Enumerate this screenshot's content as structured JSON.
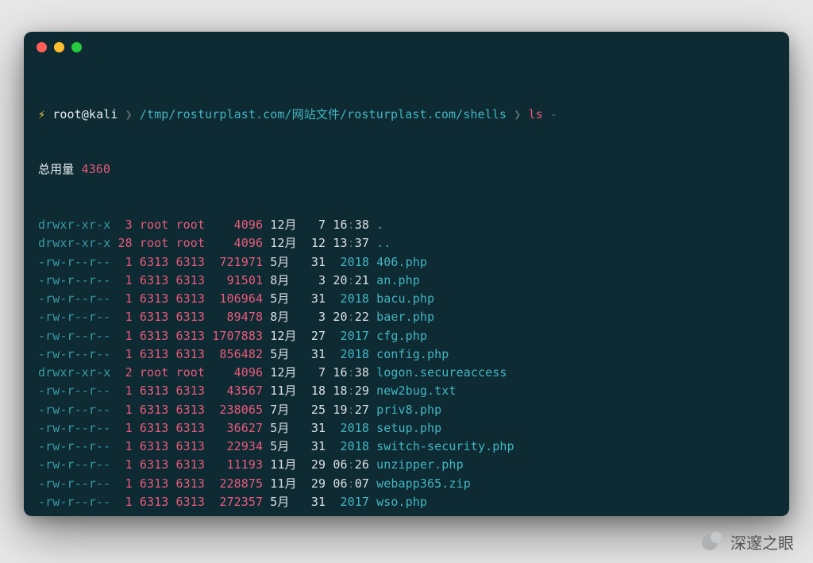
{
  "prompt": {
    "bolt": "⚡",
    "user_host": "root@kali",
    "sep": "❯",
    "path": "/tmp/rosturplast.com/网站文件/rosturplast.com/shells",
    "command": "ls",
    "flag": "-"
  },
  "total_label": "总用量",
  "total_value": "4360",
  "rows": [
    {
      "perm": "drwxr-xr-x",
      "links": "3",
      "owner": "root",
      "group": "root",
      "size": "4096",
      "mon": "12月",
      "day": "7",
      "time": "16:38",
      "year": "",
      "name": "."
    },
    {
      "perm": "drwxr-xr-x",
      "links": "28",
      "owner": "root",
      "group": "root",
      "size": "4096",
      "mon": "12月",
      "day": "12",
      "time": "13:37",
      "year": "",
      "name": ".."
    },
    {
      "perm": "-rw-r--r--",
      "links": "1",
      "owner": "6313",
      "group": "6313",
      "size": "721971",
      "mon": "5月",
      "day": "31",
      "time": "",
      "year": "2018",
      "name": "406.php"
    },
    {
      "perm": "-rw-r--r--",
      "links": "1",
      "owner": "6313",
      "group": "6313",
      "size": "91501",
      "mon": "8月",
      "day": "3",
      "time": "20:21",
      "year": "",
      "name": "an.php"
    },
    {
      "perm": "-rw-r--r--",
      "links": "1",
      "owner": "6313",
      "group": "6313",
      "size": "106964",
      "mon": "5月",
      "day": "31",
      "time": "",
      "year": "2018",
      "name": "bacu.php"
    },
    {
      "perm": "-rw-r--r--",
      "links": "1",
      "owner": "6313",
      "group": "6313",
      "size": "89478",
      "mon": "8月",
      "day": "3",
      "time": "20:22",
      "year": "",
      "name": "baer.php"
    },
    {
      "perm": "-rw-r--r--",
      "links": "1",
      "owner": "6313",
      "group": "6313",
      "size": "1707883",
      "mon": "12月",
      "day": "27",
      "time": "",
      "year": "2017",
      "name": "cfg.php"
    },
    {
      "perm": "-rw-r--r--",
      "links": "1",
      "owner": "6313",
      "group": "6313",
      "size": "856482",
      "mon": "5月",
      "day": "31",
      "time": "",
      "year": "2018",
      "name": "config.php"
    },
    {
      "perm": "drwxr-xr-x",
      "links": "2",
      "owner": "root",
      "group": "root",
      "size": "4096",
      "mon": "12月",
      "day": "7",
      "time": "16:38",
      "year": "",
      "name": "logon.secureaccess"
    },
    {
      "perm": "-rw-r--r--",
      "links": "1",
      "owner": "6313",
      "group": "6313",
      "size": "43567",
      "mon": "11月",
      "day": "18",
      "time": "18:29",
      "year": "",
      "name": "new2bug.txt"
    },
    {
      "perm": "-rw-r--r--",
      "links": "1",
      "owner": "6313",
      "group": "6313",
      "size": "238065",
      "mon": "7月",
      "day": "25",
      "time": "19:27",
      "year": "",
      "name": "priv8.php"
    },
    {
      "perm": "-rw-r--r--",
      "links": "1",
      "owner": "6313",
      "group": "6313",
      "size": "36627",
      "mon": "5月",
      "day": "31",
      "time": "",
      "year": "2018",
      "name": "setup.php"
    },
    {
      "perm": "-rw-r--r--",
      "links": "1",
      "owner": "6313",
      "group": "6313",
      "size": "22934",
      "mon": "5月",
      "day": "31",
      "time": "",
      "year": "2018",
      "name": "switch-security.php"
    },
    {
      "perm": "-rw-r--r--",
      "links": "1",
      "owner": "6313",
      "group": "6313",
      "size": "11193",
      "mon": "11月",
      "day": "29",
      "time": "06:26",
      "year": "",
      "name": "unzipper.php"
    },
    {
      "perm": "-rw-r--r--",
      "links": "1",
      "owner": "6313",
      "group": "6313",
      "size": "228875",
      "mon": "11月",
      "day": "29",
      "time": "06:07",
      "year": "",
      "name": "webapp365.zip"
    },
    {
      "perm": "-rw-r--r--",
      "links": "1",
      "owner": "6313",
      "group": "6313",
      "size": "272357",
      "mon": "5月",
      "day": "31",
      "time": "",
      "year": "2017",
      "name": "wso.php"
    }
  ],
  "watermark": "深邃之眼"
}
